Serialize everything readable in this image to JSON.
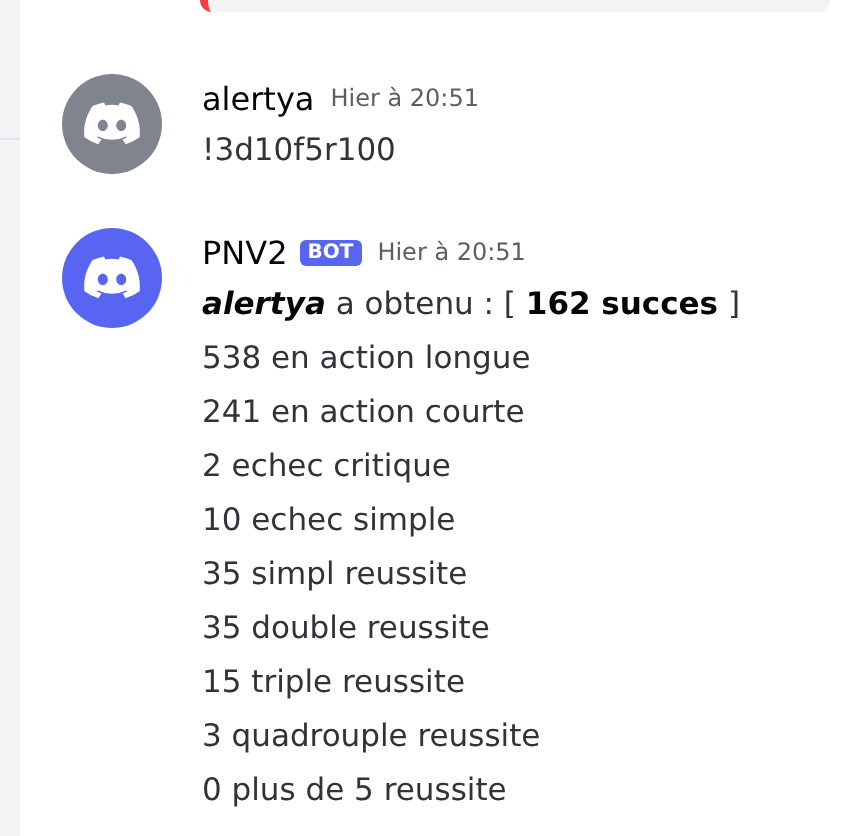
{
  "messages": [
    {
      "author": "alertya",
      "color": "#80848e",
      "timestamp": "Hier à 20:51",
      "lines": [
        "!3d10f5r100"
      ]
    },
    {
      "author": "PNV2",
      "color": "#5865f2",
      "bot_tag": "BOT",
      "timestamp": "Hier à 20:51",
      "lines": [
        "*alertya* a obtenu : [ **162 succes**  ]",
        "538 en action longue",
        "241 en action courte",
        "2 echec critique",
        "10 echec simple",
        "35 simpl reussite",
        "35 double reussite",
        "15 triple reussite",
        "3 quadrouple reussite",
        "0 plus de 5 reussite"
      ]
    }
  ]
}
